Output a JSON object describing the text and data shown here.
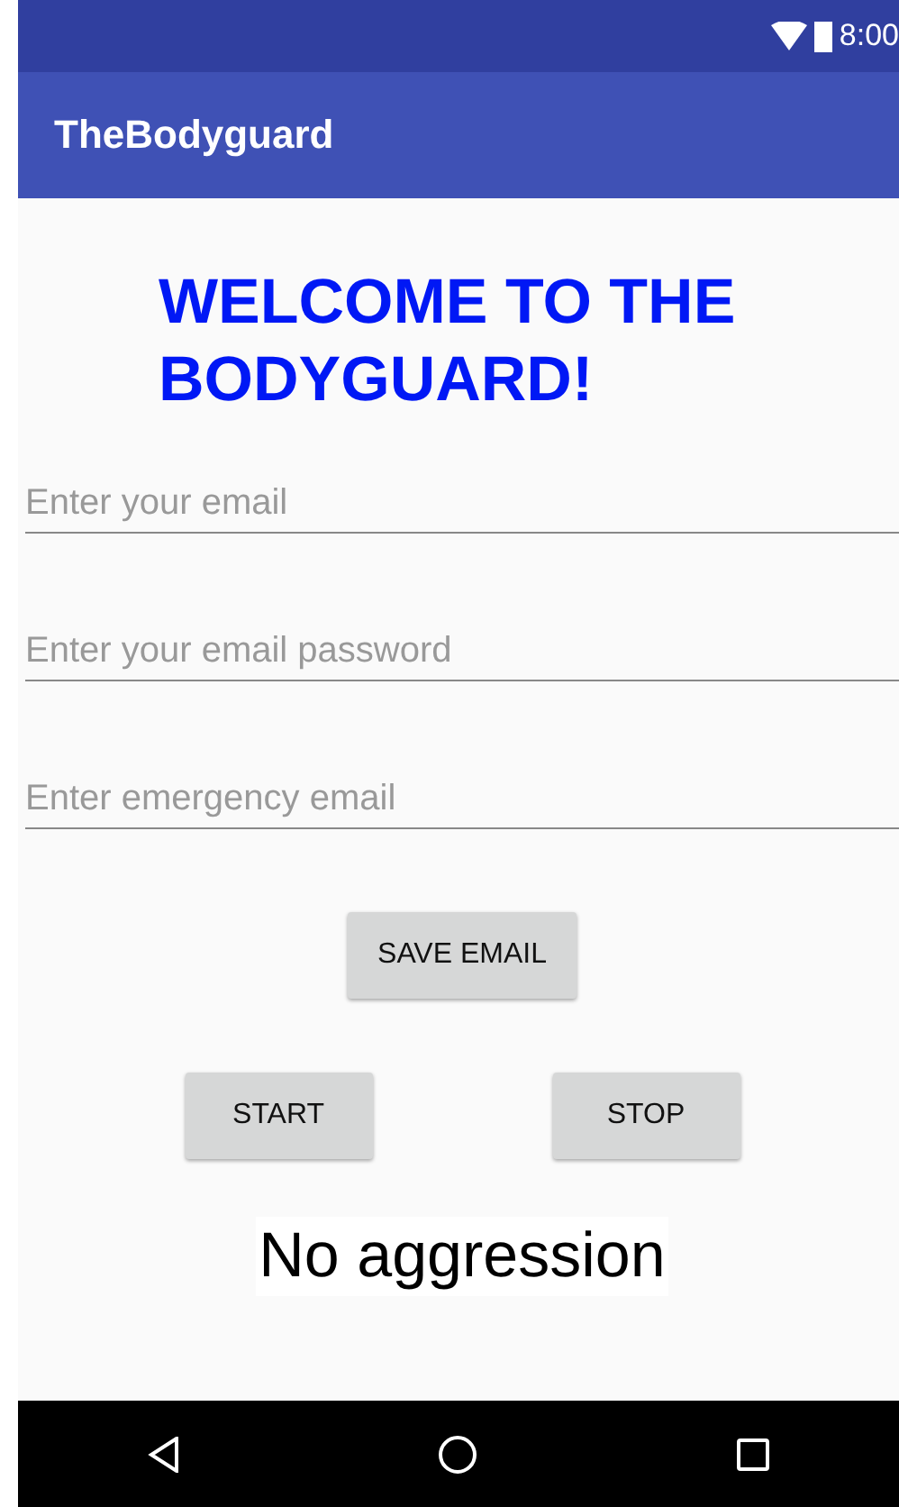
{
  "status_bar": {
    "time": "8:00"
  },
  "app_bar": {
    "title": "TheBodyguard"
  },
  "heading": "WELCOME TO THE BODYGUARD!",
  "fields": [
    {
      "placeholder": "Enter your email"
    },
    {
      "placeholder": "Enter your email password"
    },
    {
      "placeholder": "Enter emergency email"
    }
  ],
  "save_button": "SAVE EMAIL",
  "control_buttons": [
    "START",
    "STOP"
  ],
  "status_text": "No aggression"
}
